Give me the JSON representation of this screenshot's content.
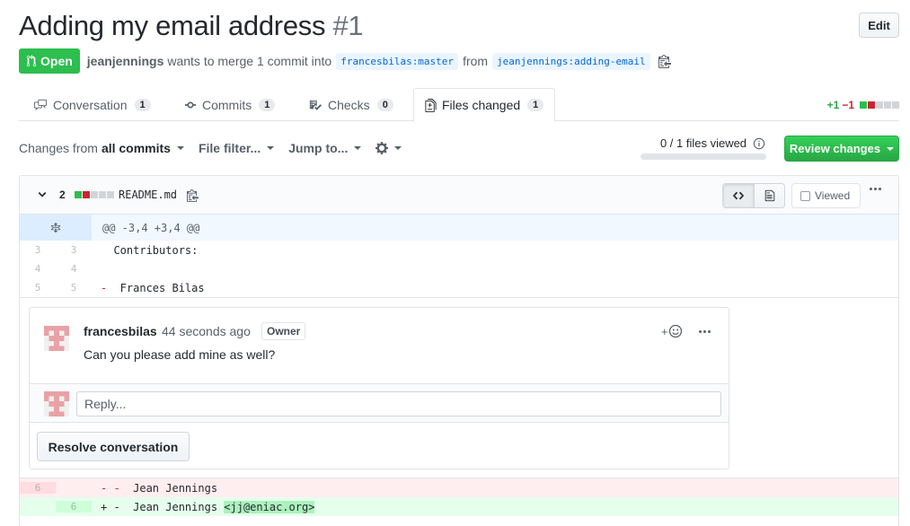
{
  "pr": {
    "title": "Adding my email address",
    "number": "#1",
    "edit_label": "Edit",
    "state_label": "Open",
    "author": "jeanjennings",
    "merge_text": "wants to merge 1 commit into",
    "base_branch": "francesbilas:master",
    "from_text": "from",
    "head_branch": "jeanjennings:adding-email"
  },
  "tabs": [
    {
      "label": "Conversation",
      "count": "1",
      "icon": "comment-discussion-icon"
    },
    {
      "label": "Commits",
      "count": "1",
      "icon": "git-commit-icon"
    },
    {
      "label": "Checks",
      "count": "0",
      "icon": "checklist-icon"
    },
    {
      "label": "Files changed",
      "count": "1",
      "icon": "file-diff-icon",
      "selected": true
    }
  ],
  "diffstat": {
    "additions": "+1",
    "deletions": "−1"
  },
  "toolbar": {
    "changes_from_prefix": "Changes from",
    "changes_from_value": "all commits",
    "file_filter": "File filter...",
    "jump_to": "Jump to...",
    "files_viewed": "0 / 1 files viewed",
    "files_viewed_fraction": 0,
    "review_button": "Review changes"
  },
  "file": {
    "change_count": "2",
    "name": "README.md",
    "viewed_label": "Viewed",
    "hunk_header": "@@ -3,4 +3,4 @@",
    "lines": [
      {
        "old": "3",
        "new": "3",
        "marker": "",
        "text": "  Contributors:"
      },
      {
        "old": "4",
        "new": "4",
        "marker": "",
        "text": ""
      },
      {
        "old": "5",
        "new": "5",
        "marker": "-",
        "text": "  Frances Bilas"
      }
    ],
    "del_line": {
      "old": "6",
      "marker": "- -",
      "text": "  Jean Jennings"
    },
    "add_line": {
      "new": "6",
      "marker": "+ -",
      "text": "  Jean Jennings ",
      "highlight": "<jj@eniac.org>"
    }
  },
  "comment": {
    "author": "francesbilas",
    "time": "44 seconds ago",
    "badge": "Owner",
    "body": "Can you please add mine as well?",
    "reply_placeholder": "Reply...",
    "resolve_label": "Resolve conversation"
  },
  "colors": {
    "open_green": "#2cbe4e",
    "review_green": "#28a745",
    "link_blue": "#0366d6",
    "deletion_red": "#cb2431",
    "avatar_pink": "#e8a2a5"
  }
}
